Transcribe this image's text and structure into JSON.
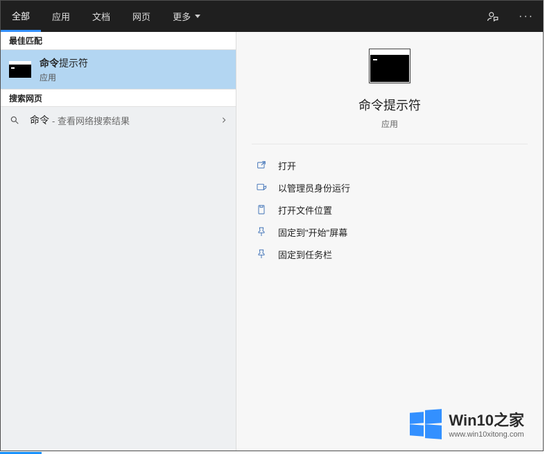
{
  "tabs": {
    "items": [
      "全部",
      "应用",
      "文档",
      "网页",
      "更多"
    ],
    "active_index": 0
  },
  "left": {
    "best_match_header": "最佳匹配",
    "result": {
      "title_bold": "命令",
      "title_rest": "提示符",
      "category": "应用"
    },
    "search_web_header": "搜索网页",
    "web_row": {
      "query": "命令",
      "hint": "- 查看网络搜索结果"
    }
  },
  "detail": {
    "title": "命令提示符",
    "category": "应用",
    "actions": [
      "打开",
      "以管理员身份运行",
      "打开文件位置",
      "固定到\"开始\"屏幕",
      "固定到任务栏"
    ]
  },
  "watermark": {
    "name": "Win10",
    "suffix": "之家",
    "url": "www.win10xitong.com"
  }
}
